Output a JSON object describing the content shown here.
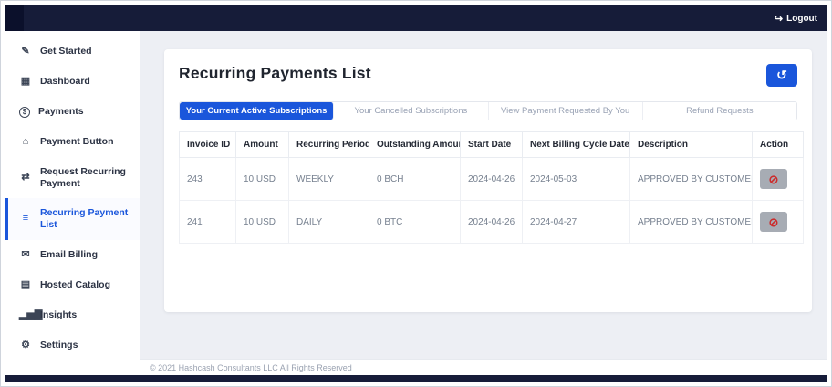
{
  "topbar": {
    "logout_label": "Logout",
    "logout_icon": "↪"
  },
  "sidebar": {
    "items": [
      {
        "label": "Get Started",
        "icon": "✎",
        "icon_name": "clipboard-icon",
        "active": false
      },
      {
        "label": "Dashboard",
        "icon": "▦",
        "icon_name": "grid-icon",
        "active": false
      },
      {
        "label": "Payments",
        "icon": "$",
        "icon_name": "dollar-circle-icon",
        "circle": true,
        "active": false
      },
      {
        "label": "Payment Button",
        "icon": "⌂",
        "icon_name": "bank-icon",
        "active": false
      },
      {
        "label": "Request Recurring Payment",
        "icon": "⇄",
        "icon_name": "exchange-icon",
        "active": false
      },
      {
        "label": "Recurring Payment List",
        "icon": "≡",
        "icon_name": "list-icon",
        "active": true
      },
      {
        "label": "Email Billing",
        "icon": "✉",
        "icon_name": "envelope-icon",
        "active": false
      },
      {
        "label": "Hosted Catalog",
        "icon": "▤",
        "icon_name": "catalog-icon",
        "active": false
      },
      {
        "label": "Insights",
        "icon": "▂▅▇",
        "icon_name": "bar-chart-icon",
        "active": false
      },
      {
        "label": "Settings",
        "icon": "⚙",
        "icon_name": "gear-icon",
        "active": false
      }
    ]
  },
  "main": {
    "title": "Recurring Payments List",
    "refresh_icon": "↺",
    "tabs": [
      {
        "label": "Your Current Active Subscriptions",
        "active": true
      },
      {
        "label": "Your Cancelled Subscriptions",
        "active": false
      },
      {
        "label": "View Payment Requested By You",
        "active": false
      },
      {
        "label": "Refund Requests",
        "active": false
      }
    ],
    "table": {
      "headers": [
        "Invoice ID",
        "Amount",
        "Recurring Period",
        "Outstanding Amount",
        "Start Date",
        "Next Billing Cycle Date",
        "Description",
        "Action"
      ],
      "action_icon": "⊘",
      "rows": [
        {
          "invoice_id": "243",
          "amount": "10 USD",
          "period": "WEEKLY",
          "outstanding": "0 BCH",
          "start_date": "2024-04-26",
          "next_billing": "2024-05-03",
          "description": "APPROVED BY CUSTOMER"
        },
        {
          "invoice_id": "241",
          "amount": "10 USD",
          "period": "DAILY",
          "outstanding": "0 BTC",
          "start_date": "2024-04-26",
          "next_billing": "2024-04-27",
          "description": "APPROVED BY CUSTOMER"
        }
      ]
    }
  },
  "footer": {
    "copyright": "© 2021 Hashcash Consultants LLC All Rights Reserved"
  },
  "colors": {
    "accent": "#1a56db",
    "topbar": "#161c39",
    "danger": "#cc2b2b",
    "action_button_bg": "#a7acb4",
    "main_bg": "#edeff4"
  }
}
